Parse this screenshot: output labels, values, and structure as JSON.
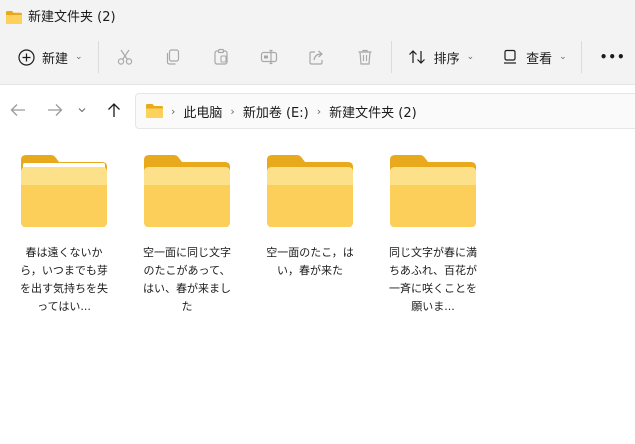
{
  "window": {
    "title": "新建文件夹 (2)"
  },
  "toolbar": {
    "new_label": "新建",
    "sort_label": "排序",
    "view_label": "查看",
    "more_label": "•••"
  },
  "address": {
    "crumbs": [
      "此电脑",
      "新加卷 (E:)",
      "新建文件夹 (2)"
    ]
  },
  "items": [
    {
      "name": "春は遠くないから，いつまでも芽を出す気持ちを失ってはい..."
    },
    {
      "name": "空一面に同じ文字のたこがあって、はい、春が来ました"
    },
    {
      "name": "空一面のたこ，はい，春が来た"
    },
    {
      "name": "同じ文字が春に満ちあふれ、百花が一斉に咲くことを願いま..."
    }
  ],
  "colors": {
    "folder": "#f7c94a",
    "folder_light": "#fde189",
    "background": "#f3f3f3"
  }
}
